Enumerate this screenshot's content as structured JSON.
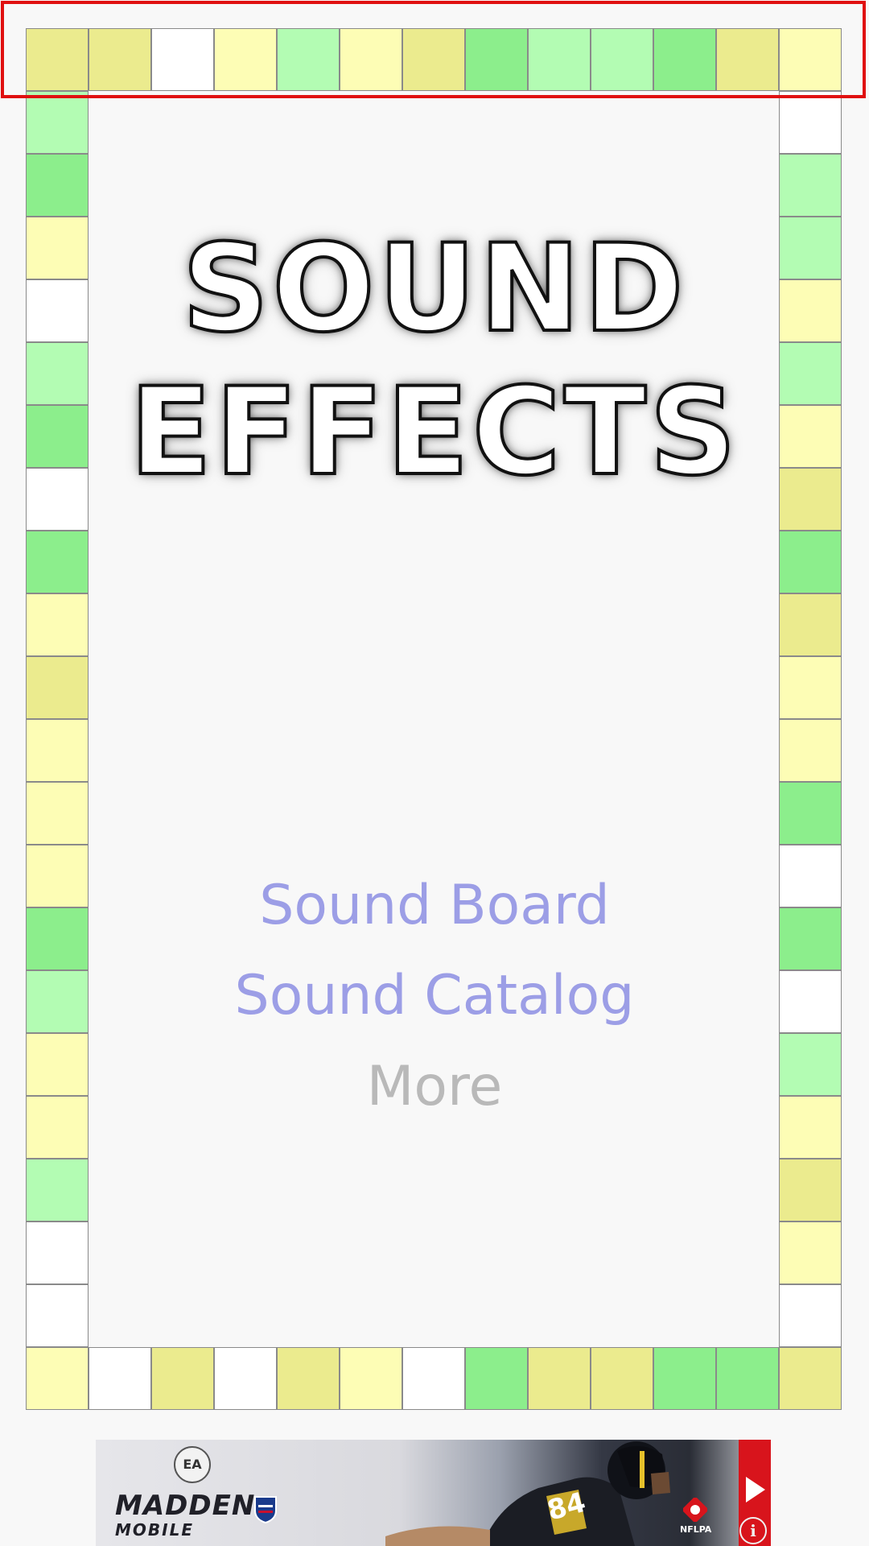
{
  "title": {
    "line1": "SOUND",
    "line2": "EFFECTS"
  },
  "menu": {
    "sound_board": "Sound Board",
    "sound_catalog": "Sound Catalog",
    "more": "More"
  },
  "colors": {
    "menu_active": "#9c9ee6",
    "menu_inactive": "#b9b9b9",
    "background": "#f8f8f8",
    "highlight": "#e01010",
    "tile_palette": {
      "W": "#ffffff",
      "Y": "#fdfdb5",
      "O": "#ebeb8e",
      "L": "#b3fcb3",
      "G": "#8cee8c"
    }
  },
  "border_tiles": {
    "top": [
      "O",
      "O",
      "W",
      "Y",
      "L",
      "Y",
      "O",
      "G",
      "L",
      "L",
      "G",
      "O",
      "Y"
    ],
    "left": [
      "L",
      "G",
      "Y",
      "W",
      "L",
      "G",
      "W",
      "G",
      "Y",
      "O",
      "Y",
      "Y",
      "Y",
      "G",
      "L",
      "Y",
      "Y",
      "L",
      "W",
      "W"
    ],
    "right": [
      "W",
      "L",
      "L",
      "Y",
      "L",
      "Y",
      "O",
      "G",
      "O",
      "Y",
      "Y",
      "G",
      "W",
      "G",
      "W",
      "L",
      "Y",
      "O",
      "Y",
      "W"
    ],
    "bottom": [
      "Y",
      "W",
      "O",
      "W",
      "O",
      "Y",
      "W",
      "G",
      "O",
      "O",
      "G",
      "G",
      "O"
    ]
  },
  "ad": {
    "brand_mark": "EA",
    "title": "MADDEN",
    "subtitle": "MOBILE",
    "nflpa": "NFLPA",
    "play_icon": "play-icon",
    "info_icon": "info-icon"
  }
}
